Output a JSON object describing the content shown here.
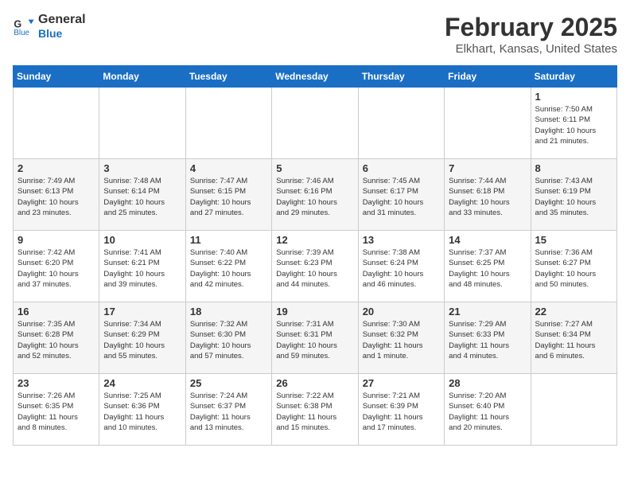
{
  "header": {
    "logo_line1": "General",
    "logo_line2": "Blue",
    "title": "February 2025",
    "subtitle": "Elkhart, Kansas, United States"
  },
  "days_of_week": [
    "Sunday",
    "Monday",
    "Tuesday",
    "Wednesday",
    "Thursday",
    "Friday",
    "Saturday"
  ],
  "weeks": [
    [
      {
        "day": "",
        "info": ""
      },
      {
        "day": "",
        "info": ""
      },
      {
        "day": "",
        "info": ""
      },
      {
        "day": "",
        "info": ""
      },
      {
        "day": "",
        "info": ""
      },
      {
        "day": "",
        "info": ""
      },
      {
        "day": "1",
        "info": "Sunrise: 7:50 AM\nSunset: 6:11 PM\nDaylight: 10 hours\nand 21 minutes."
      }
    ],
    [
      {
        "day": "2",
        "info": "Sunrise: 7:49 AM\nSunset: 6:13 PM\nDaylight: 10 hours\nand 23 minutes."
      },
      {
        "day": "3",
        "info": "Sunrise: 7:48 AM\nSunset: 6:14 PM\nDaylight: 10 hours\nand 25 minutes."
      },
      {
        "day": "4",
        "info": "Sunrise: 7:47 AM\nSunset: 6:15 PM\nDaylight: 10 hours\nand 27 minutes."
      },
      {
        "day": "5",
        "info": "Sunrise: 7:46 AM\nSunset: 6:16 PM\nDaylight: 10 hours\nand 29 minutes."
      },
      {
        "day": "6",
        "info": "Sunrise: 7:45 AM\nSunset: 6:17 PM\nDaylight: 10 hours\nand 31 minutes."
      },
      {
        "day": "7",
        "info": "Sunrise: 7:44 AM\nSunset: 6:18 PM\nDaylight: 10 hours\nand 33 minutes."
      },
      {
        "day": "8",
        "info": "Sunrise: 7:43 AM\nSunset: 6:19 PM\nDaylight: 10 hours\nand 35 minutes."
      }
    ],
    [
      {
        "day": "9",
        "info": "Sunrise: 7:42 AM\nSunset: 6:20 PM\nDaylight: 10 hours\nand 37 minutes."
      },
      {
        "day": "10",
        "info": "Sunrise: 7:41 AM\nSunset: 6:21 PM\nDaylight: 10 hours\nand 39 minutes."
      },
      {
        "day": "11",
        "info": "Sunrise: 7:40 AM\nSunset: 6:22 PM\nDaylight: 10 hours\nand 42 minutes."
      },
      {
        "day": "12",
        "info": "Sunrise: 7:39 AM\nSunset: 6:23 PM\nDaylight: 10 hours\nand 44 minutes."
      },
      {
        "day": "13",
        "info": "Sunrise: 7:38 AM\nSunset: 6:24 PM\nDaylight: 10 hours\nand 46 minutes."
      },
      {
        "day": "14",
        "info": "Sunrise: 7:37 AM\nSunset: 6:25 PM\nDaylight: 10 hours\nand 48 minutes."
      },
      {
        "day": "15",
        "info": "Sunrise: 7:36 AM\nSunset: 6:27 PM\nDaylight: 10 hours\nand 50 minutes."
      }
    ],
    [
      {
        "day": "16",
        "info": "Sunrise: 7:35 AM\nSunset: 6:28 PM\nDaylight: 10 hours\nand 52 minutes."
      },
      {
        "day": "17",
        "info": "Sunrise: 7:34 AM\nSunset: 6:29 PM\nDaylight: 10 hours\nand 55 minutes."
      },
      {
        "day": "18",
        "info": "Sunrise: 7:32 AM\nSunset: 6:30 PM\nDaylight: 10 hours\nand 57 minutes."
      },
      {
        "day": "19",
        "info": "Sunrise: 7:31 AM\nSunset: 6:31 PM\nDaylight: 10 hours\nand 59 minutes."
      },
      {
        "day": "20",
        "info": "Sunrise: 7:30 AM\nSunset: 6:32 PM\nDaylight: 11 hours\nand 1 minute."
      },
      {
        "day": "21",
        "info": "Sunrise: 7:29 AM\nSunset: 6:33 PM\nDaylight: 11 hours\nand 4 minutes."
      },
      {
        "day": "22",
        "info": "Sunrise: 7:27 AM\nSunset: 6:34 PM\nDaylight: 11 hours\nand 6 minutes."
      }
    ],
    [
      {
        "day": "23",
        "info": "Sunrise: 7:26 AM\nSunset: 6:35 PM\nDaylight: 11 hours\nand 8 minutes."
      },
      {
        "day": "24",
        "info": "Sunrise: 7:25 AM\nSunset: 6:36 PM\nDaylight: 11 hours\nand 10 minutes."
      },
      {
        "day": "25",
        "info": "Sunrise: 7:24 AM\nSunset: 6:37 PM\nDaylight: 11 hours\nand 13 minutes."
      },
      {
        "day": "26",
        "info": "Sunrise: 7:22 AM\nSunset: 6:38 PM\nDaylight: 11 hours\nand 15 minutes."
      },
      {
        "day": "27",
        "info": "Sunrise: 7:21 AM\nSunset: 6:39 PM\nDaylight: 11 hours\nand 17 minutes."
      },
      {
        "day": "28",
        "info": "Sunrise: 7:20 AM\nSunset: 6:40 PM\nDaylight: 11 hours\nand 20 minutes."
      },
      {
        "day": "",
        "info": ""
      }
    ]
  ]
}
